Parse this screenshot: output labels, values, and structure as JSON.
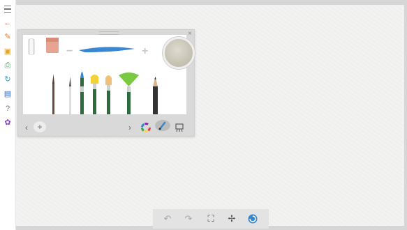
{
  "app_bar": {
    "items": [
      {
        "icon": "hamburger-menu-icon"
      },
      {
        "icon": "back-arrow-icon",
        "glyph": "←",
        "color": "#d9534f"
      },
      {
        "icon": "brush-tool-icon",
        "glyph": "✎",
        "color": "#e07b2a"
      },
      {
        "icon": "folder-icon",
        "glyph": "▣",
        "color": "#e0a82a"
      },
      {
        "icon": "print-icon",
        "glyph": "⎙",
        "color": "#3aa84a"
      },
      {
        "icon": "share-icon",
        "glyph": "↻",
        "color": "#2a9ad0"
      },
      {
        "icon": "save-icon",
        "glyph": "▤",
        "color": "#2a6ad0"
      },
      {
        "icon": "help-icon",
        "glyph": "?",
        "color": "#7a7a7a"
      },
      {
        "icon": "settings-icon",
        "glyph": "✿",
        "color": "#8a3ad0"
      }
    ]
  },
  "brush_panel": {
    "close_glyph": "×",
    "size_decrease_glyph": "−",
    "size_increase_glyph": "+",
    "stroke_color": "#3a86d0",
    "current_color": "#cbc7b8",
    "nav_prev_glyph": "‹",
    "nav_next_glyph": "›",
    "add_brush_glyph": "+"
  },
  "bottom_toolbar": {
    "undo_glyph": "↶",
    "redo_glyph": "↷",
    "fit_glyph": "⛶",
    "fan_glyph": "✢"
  }
}
